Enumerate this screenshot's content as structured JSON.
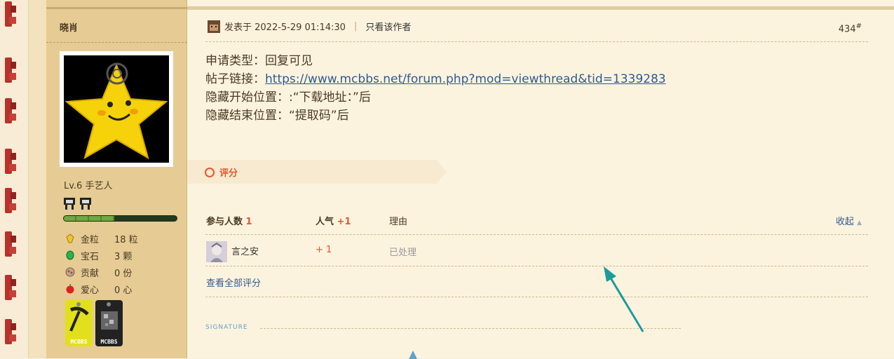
{
  "user": {
    "name": "晓肖",
    "level": "Lv.6 手艺人",
    "stats": [
      {
        "icon": "gold-nugget-icon",
        "label": "金粒",
        "value": "18 粒"
      },
      {
        "icon": "emerald-icon",
        "label": "宝石",
        "value": "3 颗"
      },
      {
        "icon": "contribution-icon",
        "label": "贡献",
        "value": "0 份"
      },
      {
        "icon": "apple-heart-icon",
        "label": "爱心",
        "value": "0 心"
      }
    ],
    "level_progress": 0.45,
    "medals": [
      {
        "icon": "pickaxe-medal-icon",
        "text": "MCBBS"
      },
      {
        "icon": "ore-medal-icon",
        "text": "MCBBS"
      }
    ]
  },
  "post": {
    "posted_label": "发表于 2022-5-29 01:14:30",
    "separator": "|",
    "author_only": "只看该作者",
    "floor_number": "434",
    "floor_suffix": "#",
    "lines": [
      {
        "label": "申请类型：",
        "value": "回复可见"
      },
      {
        "label": "帖子链接：",
        "link": "https://www.mcbbs.net/forum.php?mod=viewthread&tid=1339283"
      },
      {
        "label": "隐藏开始位置：",
        "value": ":“下载地址：”后"
      },
      {
        "label": "隐藏结束位置：",
        "value": "“提取码”后"
      }
    ]
  },
  "rating": {
    "title": "评分",
    "participants_label": "参与人数",
    "participants_count": "1",
    "popularity_label": "人气",
    "popularity_value": "+1",
    "reason_label": "理由",
    "collapse_label": "收起",
    "entries": [
      {
        "user": "言之安",
        "score": "+ 1",
        "reason": "已处理"
      }
    ],
    "view_all": "查看全部评分"
  },
  "signature_label": "SIGNATURE",
  "colors": {
    "accent": "#e4572e",
    "link": "#2f5a93",
    "arrow": "#1a9c9a",
    "sidebar": "#e6cb94"
  }
}
